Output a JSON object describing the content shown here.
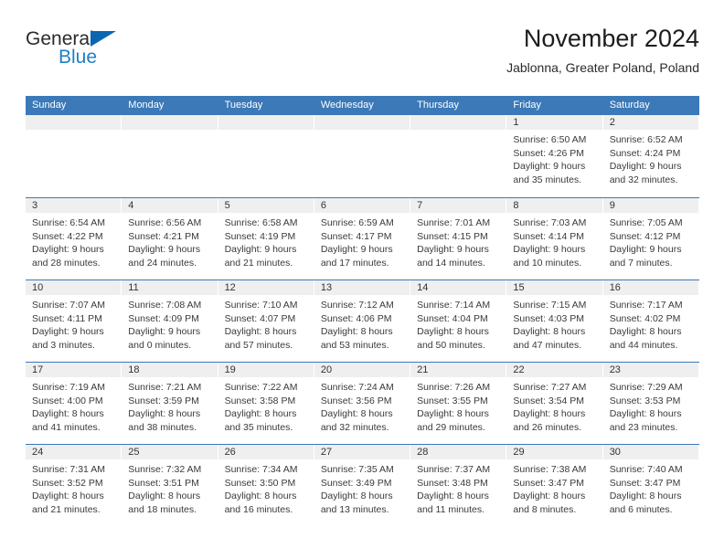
{
  "brand": {
    "name_part1": "General",
    "name_part2": "Blue"
  },
  "header": {
    "title": "November 2024",
    "subtitle": "Jablonna, Greater Poland, Poland"
  },
  "colors": {
    "header_blue": "#3b79b8",
    "logo_blue": "#1f7fc4",
    "date_band": "#efefef"
  },
  "weekday_headers": [
    "Sunday",
    "Monday",
    "Tuesday",
    "Wednesday",
    "Thursday",
    "Friday",
    "Saturday"
  ],
  "weeks": [
    [
      {
        "empty": true
      },
      {
        "empty": true
      },
      {
        "empty": true
      },
      {
        "empty": true
      },
      {
        "empty": true
      },
      {
        "day": "1",
        "sunrise": "Sunrise: 6:50 AM",
        "sunset": "Sunset: 4:26 PM",
        "daylight1": "Daylight: 9 hours",
        "daylight2": "and 35 minutes."
      },
      {
        "day": "2",
        "sunrise": "Sunrise: 6:52 AM",
        "sunset": "Sunset: 4:24 PM",
        "daylight1": "Daylight: 9 hours",
        "daylight2": "and 32 minutes."
      }
    ],
    [
      {
        "day": "3",
        "sunrise": "Sunrise: 6:54 AM",
        "sunset": "Sunset: 4:22 PM",
        "daylight1": "Daylight: 9 hours",
        "daylight2": "and 28 minutes."
      },
      {
        "day": "4",
        "sunrise": "Sunrise: 6:56 AM",
        "sunset": "Sunset: 4:21 PM",
        "daylight1": "Daylight: 9 hours",
        "daylight2": "and 24 minutes."
      },
      {
        "day": "5",
        "sunrise": "Sunrise: 6:58 AM",
        "sunset": "Sunset: 4:19 PM",
        "daylight1": "Daylight: 9 hours",
        "daylight2": "and 21 minutes."
      },
      {
        "day": "6",
        "sunrise": "Sunrise: 6:59 AM",
        "sunset": "Sunset: 4:17 PM",
        "daylight1": "Daylight: 9 hours",
        "daylight2": "and 17 minutes."
      },
      {
        "day": "7",
        "sunrise": "Sunrise: 7:01 AM",
        "sunset": "Sunset: 4:15 PM",
        "daylight1": "Daylight: 9 hours",
        "daylight2": "and 14 minutes."
      },
      {
        "day": "8",
        "sunrise": "Sunrise: 7:03 AM",
        "sunset": "Sunset: 4:14 PM",
        "daylight1": "Daylight: 9 hours",
        "daylight2": "and 10 minutes."
      },
      {
        "day": "9",
        "sunrise": "Sunrise: 7:05 AM",
        "sunset": "Sunset: 4:12 PM",
        "daylight1": "Daylight: 9 hours",
        "daylight2": "and 7 minutes."
      }
    ],
    [
      {
        "day": "10",
        "sunrise": "Sunrise: 7:07 AM",
        "sunset": "Sunset: 4:11 PM",
        "daylight1": "Daylight: 9 hours",
        "daylight2": "and 3 minutes."
      },
      {
        "day": "11",
        "sunrise": "Sunrise: 7:08 AM",
        "sunset": "Sunset: 4:09 PM",
        "daylight1": "Daylight: 9 hours",
        "daylight2": "and 0 minutes."
      },
      {
        "day": "12",
        "sunrise": "Sunrise: 7:10 AM",
        "sunset": "Sunset: 4:07 PM",
        "daylight1": "Daylight: 8 hours",
        "daylight2": "and 57 minutes."
      },
      {
        "day": "13",
        "sunrise": "Sunrise: 7:12 AM",
        "sunset": "Sunset: 4:06 PM",
        "daylight1": "Daylight: 8 hours",
        "daylight2": "and 53 minutes."
      },
      {
        "day": "14",
        "sunrise": "Sunrise: 7:14 AM",
        "sunset": "Sunset: 4:04 PM",
        "daylight1": "Daylight: 8 hours",
        "daylight2": "and 50 minutes."
      },
      {
        "day": "15",
        "sunrise": "Sunrise: 7:15 AM",
        "sunset": "Sunset: 4:03 PM",
        "daylight1": "Daylight: 8 hours",
        "daylight2": "and 47 minutes."
      },
      {
        "day": "16",
        "sunrise": "Sunrise: 7:17 AM",
        "sunset": "Sunset: 4:02 PM",
        "daylight1": "Daylight: 8 hours",
        "daylight2": "and 44 minutes."
      }
    ],
    [
      {
        "day": "17",
        "sunrise": "Sunrise: 7:19 AM",
        "sunset": "Sunset: 4:00 PM",
        "daylight1": "Daylight: 8 hours",
        "daylight2": "and 41 minutes."
      },
      {
        "day": "18",
        "sunrise": "Sunrise: 7:21 AM",
        "sunset": "Sunset: 3:59 PM",
        "daylight1": "Daylight: 8 hours",
        "daylight2": "and 38 minutes."
      },
      {
        "day": "19",
        "sunrise": "Sunrise: 7:22 AM",
        "sunset": "Sunset: 3:58 PM",
        "daylight1": "Daylight: 8 hours",
        "daylight2": "and 35 minutes."
      },
      {
        "day": "20",
        "sunrise": "Sunrise: 7:24 AM",
        "sunset": "Sunset: 3:56 PM",
        "daylight1": "Daylight: 8 hours",
        "daylight2": "and 32 minutes."
      },
      {
        "day": "21",
        "sunrise": "Sunrise: 7:26 AM",
        "sunset": "Sunset: 3:55 PM",
        "daylight1": "Daylight: 8 hours",
        "daylight2": "and 29 minutes."
      },
      {
        "day": "22",
        "sunrise": "Sunrise: 7:27 AM",
        "sunset": "Sunset: 3:54 PM",
        "daylight1": "Daylight: 8 hours",
        "daylight2": "and 26 minutes."
      },
      {
        "day": "23",
        "sunrise": "Sunrise: 7:29 AM",
        "sunset": "Sunset: 3:53 PM",
        "daylight1": "Daylight: 8 hours",
        "daylight2": "and 23 minutes."
      }
    ],
    [
      {
        "day": "24",
        "sunrise": "Sunrise: 7:31 AM",
        "sunset": "Sunset: 3:52 PM",
        "daylight1": "Daylight: 8 hours",
        "daylight2": "and 21 minutes."
      },
      {
        "day": "25",
        "sunrise": "Sunrise: 7:32 AM",
        "sunset": "Sunset: 3:51 PM",
        "daylight1": "Daylight: 8 hours",
        "daylight2": "and 18 minutes."
      },
      {
        "day": "26",
        "sunrise": "Sunrise: 7:34 AM",
        "sunset": "Sunset: 3:50 PM",
        "daylight1": "Daylight: 8 hours",
        "daylight2": "and 16 minutes."
      },
      {
        "day": "27",
        "sunrise": "Sunrise: 7:35 AM",
        "sunset": "Sunset: 3:49 PM",
        "daylight1": "Daylight: 8 hours",
        "daylight2": "and 13 minutes."
      },
      {
        "day": "28",
        "sunrise": "Sunrise: 7:37 AM",
        "sunset": "Sunset: 3:48 PM",
        "daylight1": "Daylight: 8 hours",
        "daylight2": "and 11 minutes."
      },
      {
        "day": "29",
        "sunrise": "Sunrise: 7:38 AM",
        "sunset": "Sunset: 3:47 PM",
        "daylight1": "Daylight: 8 hours",
        "daylight2": "and 8 minutes."
      },
      {
        "day": "30",
        "sunrise": "Sunrise: 7:40 AM",
        "sunset": "Sunset: 3:47 PM",
        "daylight1": "Daylight: 8 hours",
        "daylight2": "and 6 minutes."
      }
    ]
  ]
}
